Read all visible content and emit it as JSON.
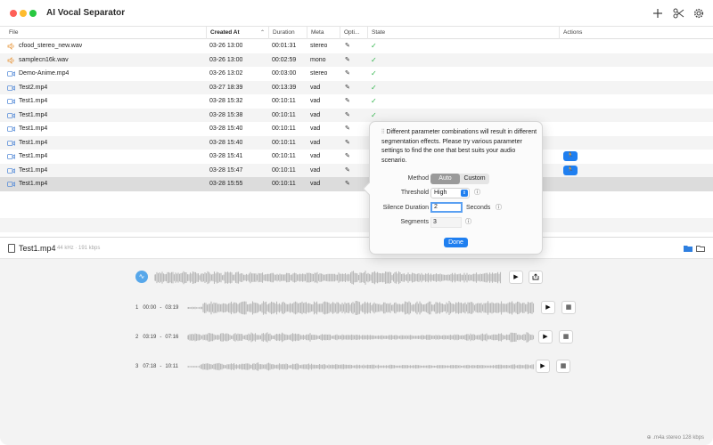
{
  "app": {
    "title": "AI Vocal Separator"
  },
  "columns": {
    "file": "File",
    "created_at": "Created At",
    "duration": "Duration",
    "meta": "Meta",
    "options": "Opti...",
    "state": "State",
    "actions": "Actions"
  },
  "rows": [
    {
      "file": "cfood_stereo_new.wav",
      "type": "audio",
      "created": "03-26 13:00",
      "duration": "00:01:31",
      "meta": "stereo",
      "state": "done"
    },
    {
      "file": "samplecn16k.wav",
      "type": "audio",
      "created": "03-26 13:00",
      "duration": "00:02:59",
      "meta": "mono",
      "state": "done"
    },
    {
      "file": "Demo-Anime.mp4",
      "type": "video",
      "created": "03-26 13:02",
      "duration": "00:03:00",
      "meta": "stereo",
      "state": "done"
    },
    {
      "file": "Test2.mp4",
      "type": "video",
      "created": "03-27 18:39",
      "duration": "00:13:39",
      "meta": "vad",
      "state": "done"
    },
    {
      "file": "Test1.mp4",
      "type": "video",
      "created": "03-28 15:32",
      "duration": "00:10:11",
      "meta": "vad",
      "state": "done"
    },
    {
      "file": "Test1.mp4",
      "type": "video",
      "created": "03-28 15:38",
      "duration": "00:10:11",
      "meta": "vad",
      "state": "done"
    },
    {
      "file": "Test1.mp4",
      "type": "video",
      "created": "03-28 15:40",
      "duration": "00:10:11",
      "meta": "vad",
      "state": ""
    },
    {
      "file": "Test1.mp4",
      "type": "video",
      "created": "03-28 15:40",
      "duration": "00:10:11",
      "meta": "vad",
      "state": ""
    },
    {
      "file": "Test1.mp4",
      "type": "video",
      "created": "03-28 15:41",
      "duration": "00:10:11",
      "meta": "vad",
      "state": "",
      "action": true
    },
    {
      "file": "Test1.mp4",
      "type": "video",
      "created": "03-28 15:47",
      "duration": "00:10:11",
      "meta": "vad",
      "state": "",
      "action": true
    },
    {
      "file": "Test1.mp4",
      "type": "video",
      "created": "03-28 15:55",
      "duration": "00:10:11",
      "meta": "vad",
      "state": "",
      "selected": true
    }
  ],
  "detail": {
    "title": "Test1.mp4",
    "meta": "44 kHz · 191 kbps",
    "segments": [
      {
        "index": "1",
        "start": "00:00",
        "sep": "-",
        "end": "03:19"
      },
      {
        "index": "2",
        "start": "03:19",
        "sep": "-",
        "end": "07:16"
      },
      {
        "index": "3",
        "start": "07:18",
        "sep": "-",
        "end": "10:11"
      }
    ]
  },
  "popover": {
    "description": "Different parameter combinations will result in different segmentation effects. Please try various parameter settings to find the one that best suits your audio scenario.",
    "method_label": "Method",
    "method_auto": "Auto",
    "method_custom": "Custom",
    "threshold_label": "Threshold",
    "threshold_value": "High",
    "silence_label": "Silence Duration",
    "silence_value": "2",
    "silence_unit": "Seconds",
    "segments_label": "Segments",
    "segments_value": "3",
    "done": "Done"
  },
  "status": {
    "text": "⊕ .m4a stereo 128 kbps"
  },
  "colors": {
    "accent": "#1f7ff0",
    "check": "#2fb34a",
    "selected_row": "#dcdcdc",
    "audio_icon": "#e8963b",
    "video_icon": "#5b8fd9"
  }
}
